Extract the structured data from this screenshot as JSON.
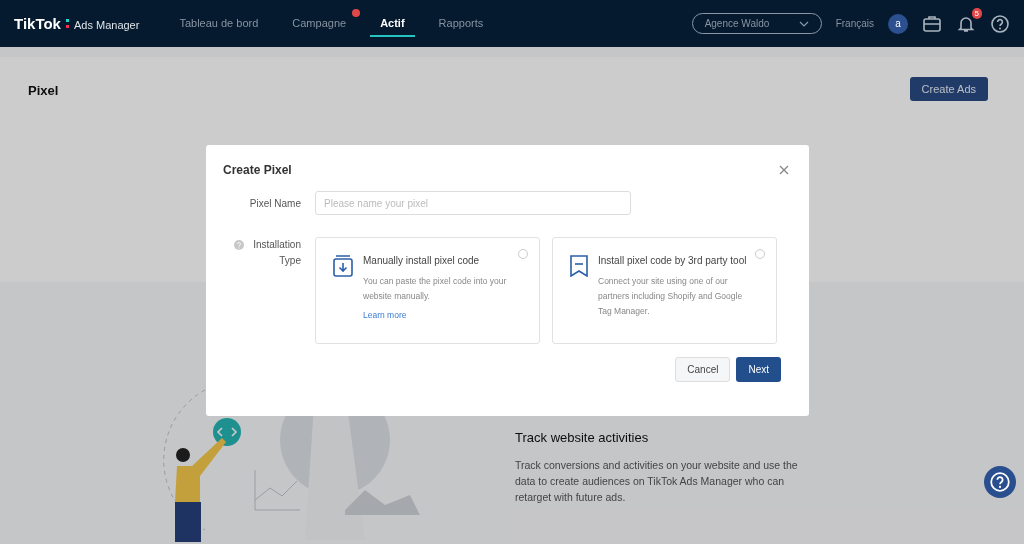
{
  "nav": {
    "logo": "TikTok",
    "logo_suffix": "Ads Manager",
    "tabs": [
      {
        "label": "Tableau de bord",
        "selected": false,
        "badge": false
      },
      {
        "label": "Campagne",
        "selected": false,
        "badge": true
      },
      {
        "label": "Actif",
        "selected": true,
        "badge": false
      },
      {
        "label": "Rapports",
        "selected": false,
        "badge": false
      }
    ],
    "account_select": "Agence Waldo",
    "language": "Français",
    "avatar": "a",
    "notification_count": "5"
  },
  "page": {
    "title": "Pixel",
    "create_button": "Create Ads",
    "feature": {
      "title": "Track website activities",
      "description": "Track conversions and activities on your website and use the data to create audiences on TikTok Ads Manager who can retarget with future ads."
    }
  },
  "modal": {
    "title": "Create Pixel",
    "name_label": "Pixel Name",
    "name_placeholder": "Please name your pixel",
    "type_label": "Installation Type",
    "options": [
      {
        "kind": "manual",
        "title": "Manually install pixel code",
        "description": "You can paste the pixel code into your website manually.",
        "link": "Learn more",
        "selected": false
      },
      {
        "kind": "partner",
        "title": "Install pixel code by 3rd party tool",
        "description": "Connect your site using one of our partners including Shopify and Google Tag Manager.",
        "selected": false
      }
    ],
    "buttons": {
      "cancel": "Cancel",
      "next": "Next"
    }
  }
}
